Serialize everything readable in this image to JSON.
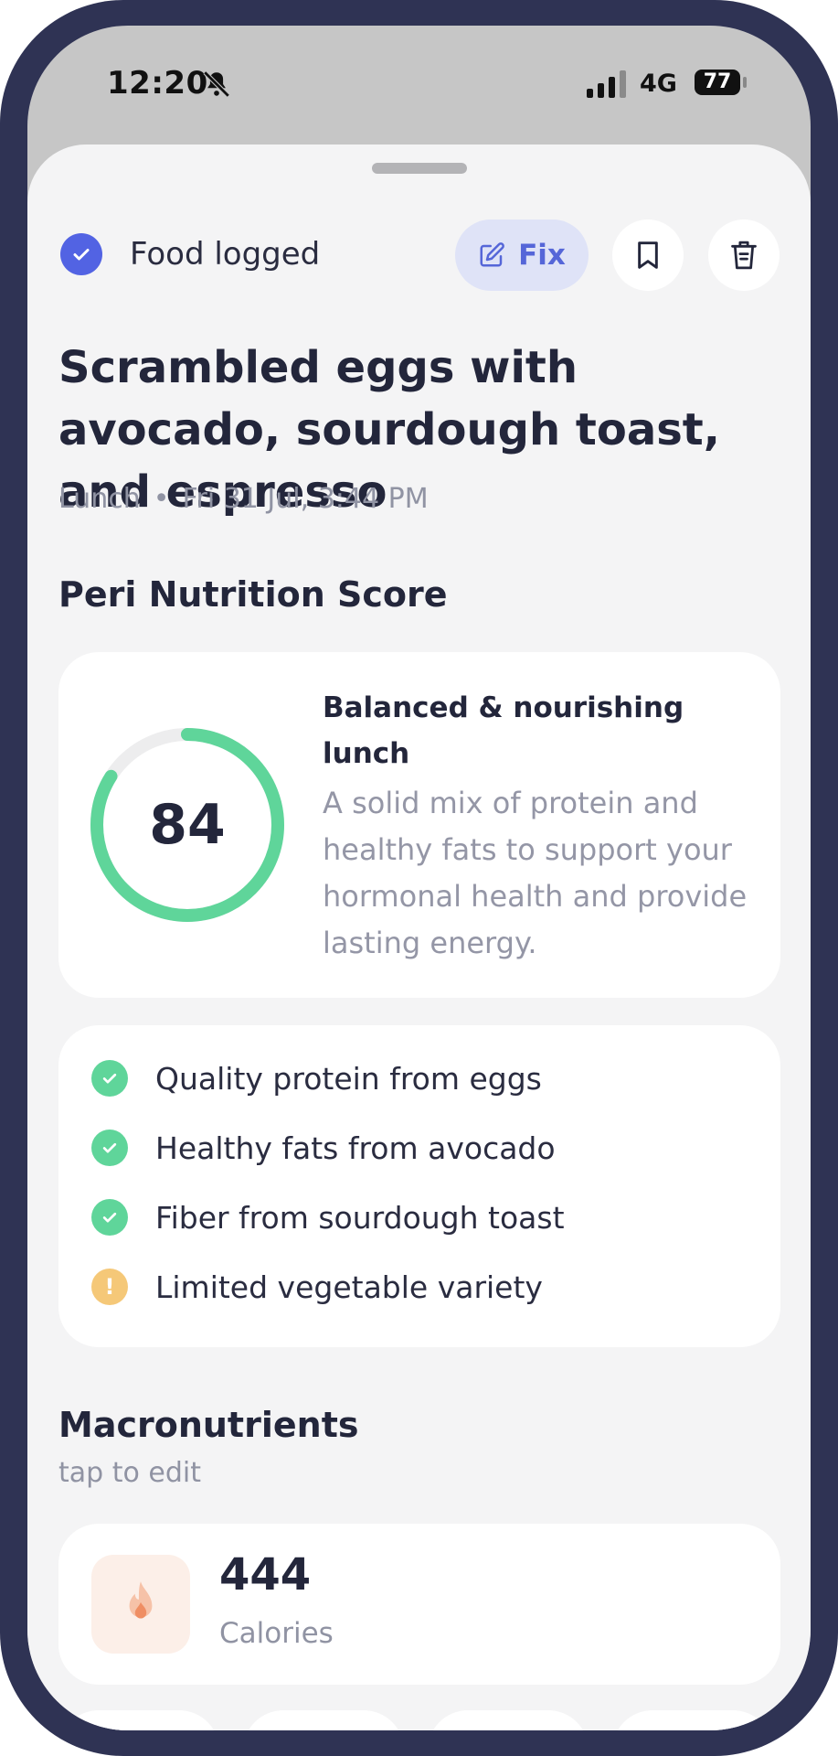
{
  "status_bar": {
    "time": "12:20",
    "network": "4G",
    "battery": "77"
  },
  "header": {
    "logged_label": "Food logged",
    "fix_label": "Fix"
  },
  "meal": {
    "title": "Scrambled eggs with avocado, sourdough toast, and espresso",
    "meal_type": "Lunch",
    "timestamp": "Fri 31 Jul, 3:44 PM"
  },
  "score": {
    "section_title": "Peri Nutrition Score",
    "value": "84",
    "max": 100,
    "headline": "Balanced & nourishing lunch",
    "description": "A solid mix of protein and healthy fats to support your hormonal health and provide lasting energy.",
    "ring_color": "#5fd59a"
  },
  "highlights": [
    {
      "text": "Quality protein from eggs",
      "status": "good"
    },
    {
      "text": "Healthy fats from avocado",
      "status": "good"
    },
    {
      "text": "Fiber from sourdough toast",
      "status": "good"
    },
    {
      "text": "Limited vegetable variety",
      "status": "warning"
    }
  ],
  "macros": {
    "section_title": "Macronutrients",
    "hint": "tap to edit",
    "calories": {
      "value": "444",
      "label": "Calories",
      "icon": "flame-icon"
    }
  },
  "colors": {
    "accent": "#5263e3",
    "good": "#5fd59a",
    "warning": "#f5c878",
    "text": "#23263b"
  }
}
